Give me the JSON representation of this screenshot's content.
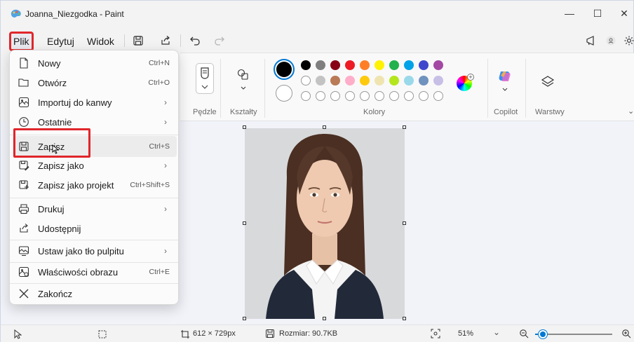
{
  "window": {
    "title": "Joanna_Niezgodka - Paint",
    "minimize": "—",
    "maximize": "☐",
    "close": "✕"
  },
  "menubar": {
    "items": [
      {
        "label": "Plik"
      },
      {
        "label": "Edytuj"
      },
      {
        "label": "Widok"
      }
    ]
  },
  "ribbon": {
    "brushes_label": "Pędzle",
    "shapes_label": "Kształty",
    "colors_label": "Kolory",
    "copilot_label": "Copilot",
    "layers_label": "Warstwy",
    "primary_color": "#000000",
    "secondary_color": "#ffffff",
    "palette_row1": [
      "#000000",
      "#7f7f7f",
      "#880015",
      "#ed1c24",
      "#ff7f27",
      "#fff200",
      "#22b14c",
      "#00a2e8",
      "#3f48cc",
      "#a349a4"
    ],
    "palette_row2": [
      "#ffffff",
      "#c3c3c3",
      "#b97a57",
      "#ffaec9",
      "#ffc90e",
      "#efe4b0",
      "#b5e61d",
      "#99d9ea",
      "#7092be",
      "#c8bfe7"
    ]
  },
  "file_menu": {
    "items": [
      {
        "label": "Nowy",
        "shortcut": "Ctrl+N",
        "arrow": ""
      },
      {
        "label": "Otwórz",
        "shortcut": "Ctrl+O",
        "arrow": ""
      },
      {
        "label": "Importuj do kanwy",
        "shortcut": "",
        "arrow": "›"
      },
      {
        "label": "Ostatnie",
        "shortcut": "",
        "arrow": "›"
      },
      {
        "label": "Zapisz",
        "shortcut": "Ctrl+S",
        "arrow": ""
      },
      {
        "label": "Zapisz jako",
        "shortcut": "",
        "arrow": "›"
      },
      {
        "label": "Zapisz jako projekt",
        "shortcut": "Ctrl+Shift+S",
        "arrow": ""
      },
      {
        "label": "Drukuj",
        "shortcut": "",
        "arrow": "›"
      },
      {
        "label": "Udostępnij",
        "shortcut": "",
        "arrow": ""
      },
      {
        "label": "Ustaw jako tło pulpitu",
        "shortcut": "",
        "arrow": "›"
      },
      {
        "label": "Właściwości obrazu",
        "shortcut": "Ctrl+E",
        "arrow": ""
      },
      {
        "label": "Zakończ",
        "shortcut": "",
        "arrow": ""
      }
    ]
  },
  "statusbar": {
    "dimensions": "612 × 729px",
    "size": "Rozmiar: 90.7KB",
    "zoom": "51%",
    "zoom_level": 0.1
  },
  "colors": {
    "accent": "#0078d4",
    "highlight_red": "#e0262b"
  }
}
